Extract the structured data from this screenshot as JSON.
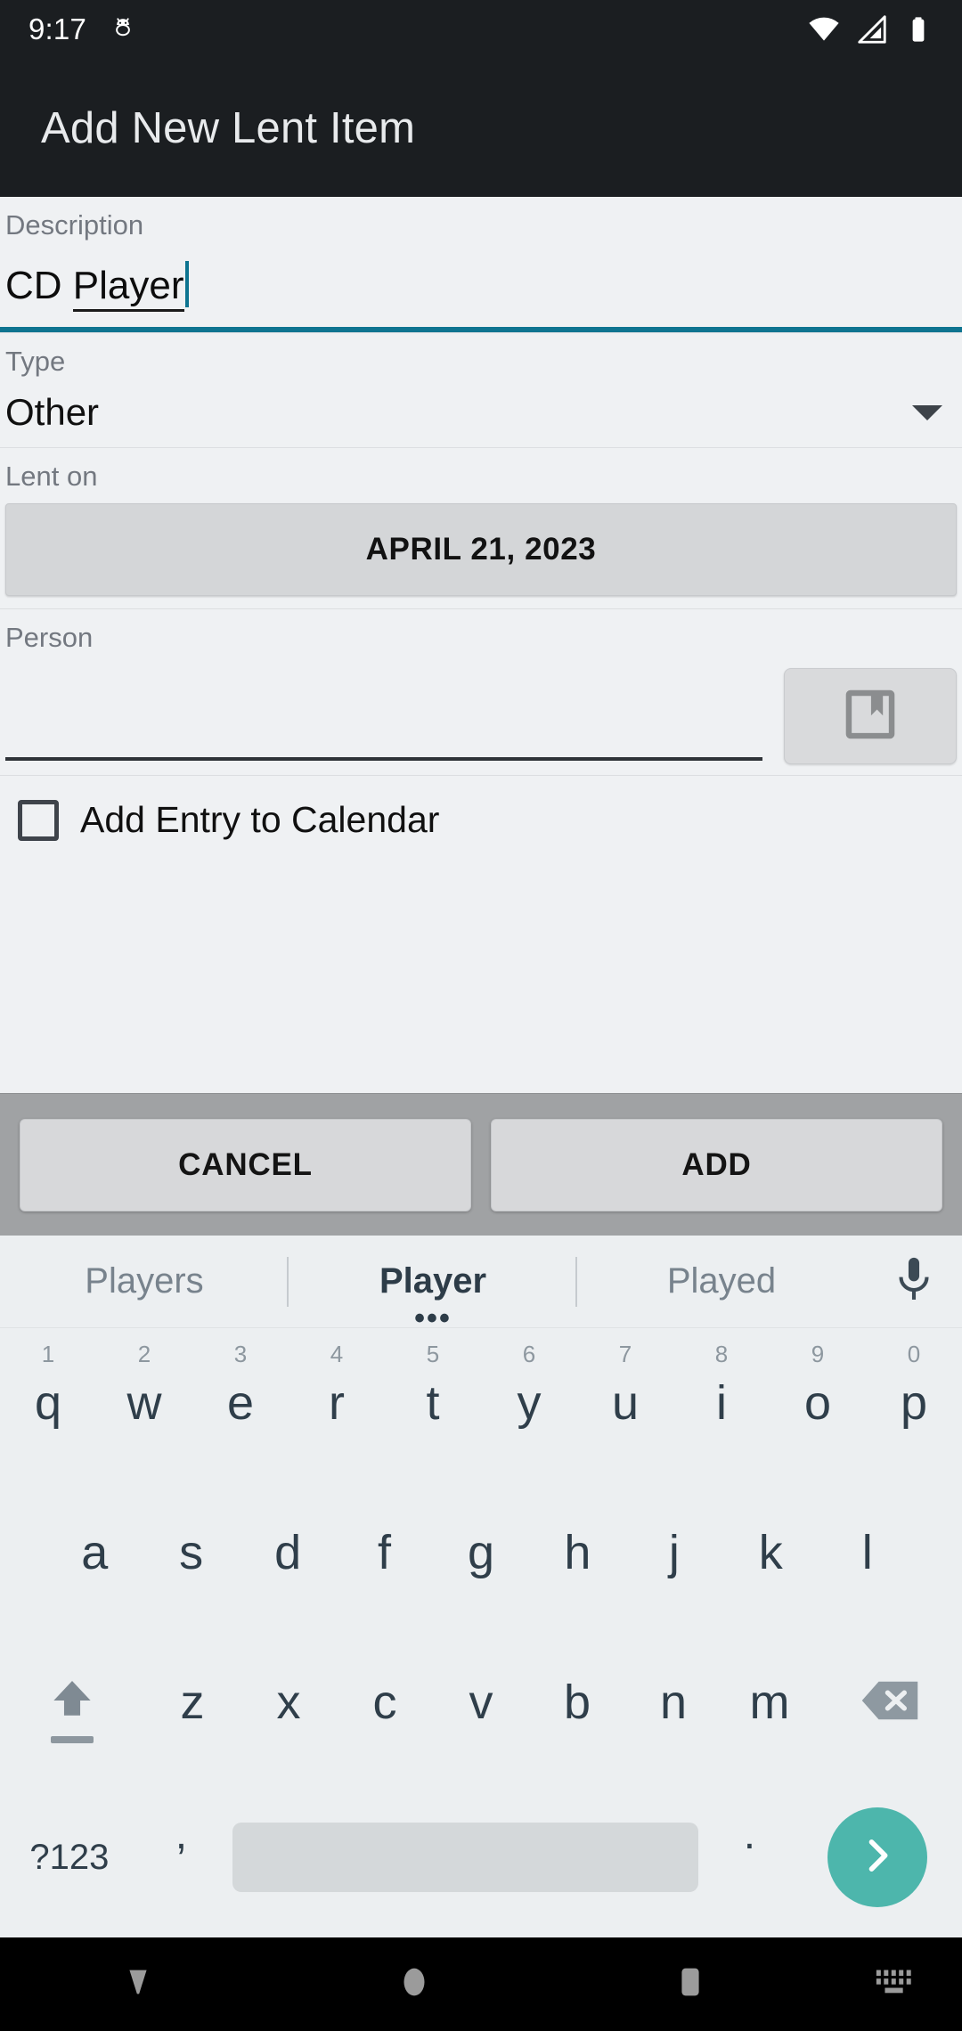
{
  "status_bar": {
    "time": "9:17",
    "icons": [
      "android-debug-icon",
      "wifi-icon",
      "cellular-signal-icon",
      "battery-icon"
    ]
  },
  "app_bar": {
    "title": "Add New Lent Item"
  },
  "form": {
    "description": {
      "label": "Description",
      "value_head": "CD ",
      "value_composing": "Player",
      "value": "CD Player",
      "accent_color": "#0e7490"
    },
    "type": {
      "label": "Type",
      "value": "Other"
    },
    "lent_on": {
      "label": "Lent on",
      "value": "APRIL 21, 2023"
    },
    "person": {
      "label": "Person",
      "value": "",
      "picker_icon": "contacts-book-icon"
    },
    "calendar_checkbox": {
      "label": "Add Entry to Calendar",
      "checked": false
    }
  },
  "actions": {
    "cancel_label": "CANCEL",
    "add_label": "ADD"
  },
  "keyboard": {
    "suggestions": [
      "Players",
      "Player",
      "Played"
    ],
    "selected_suggestion_index": 1,
    "more_dots": "•••",
    "mic_icon": "microphone-icon",
    "row1": [
      {
        "key": "q",
        "num": "1"
      },
      {
        "key": "w",
        "num": "2"
      },
      {
        "key": "e",
        "num": "3"
      },
      {
        "key": "r",
        "num": "4"
      },
      {
        "key": "t",
        "num": "5"
      },
      {
        "key": "y",
        "num": "6"
      },
      {
        "key": "u",
        "num": "7"
      },
      {
        "key": "i",
        "num": "8"
      },
      {
        "key": "o",
        "num": "9"
      },
      {
        "key": "p",
        "num": "0"
      }
    ],
    "row2": [
      "a",
      "s",
      "d",
      "f",
      "g",
      "h",
      "j",
      "k",
      "l"
    ],
    "row3": [
      "z",
      "x",
      "c",
      "v",
      "b",
      "n",
      "m"
    ],
    "shift_icon": "shift-icon",
    "backspace_icon": "backspace-icon",
    "symbols_label": "?123",
    "comma_label": ",",
    "period_label": ".",
    "space_label": "",
    "enter_icon": "chevron-right-icon",
    "enter_color": "#4db6ac"
  },
  "nav_bar": {
    "back_icon": "collapse-keyboard-icon",
    "home_icon": "home-icon",
    "recents_icon": "recents-icon",
    "keyboard_switch_icon": "keyboard-switcher-icon"
  }
}
